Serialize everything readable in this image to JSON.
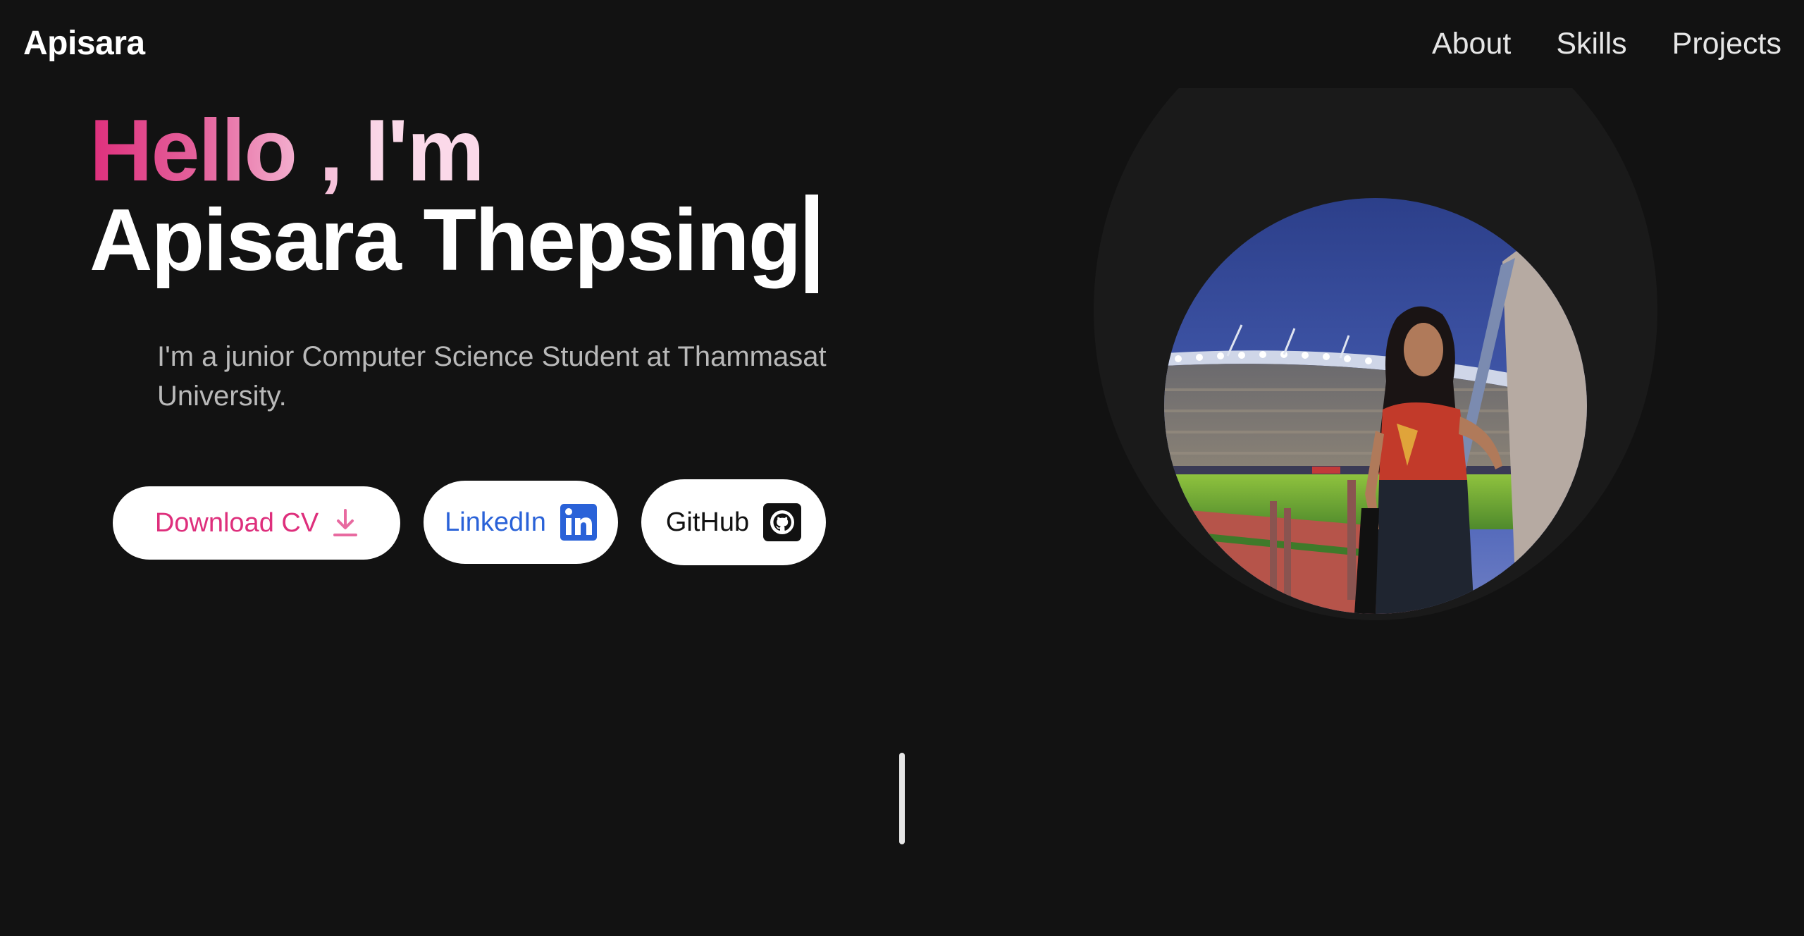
{
  "header": {
    "brand": "Apisara",
    "nav": [
      {
        "label": "About"
      },
      {
        "label": "Skills"
      },
      {
        "label": "Projects"
      }
    ]
  },
  "hero": {
    "greeting": "Hello , I'm",
    "name": "Apisara Thepsing",
    "intro": "I'm a junior Computer Science Student at Thammasat University.",
    "buttons": {
      "download_cv": "Download CV",
      "linkedin": "LinkedIn",
      "github": "GitHub"
    }
  },
  "icons": {
    "download": "download-icon",
    "linkedin": "linkedin-icon",
    "github": "github-icon"
  },
  "colors": {
    "background": "#121212",
    "accent_pink": "#de2f7c",
    "linkedin_blue": "#2a62d8",
    "text": "#ffffff"
  }
}
